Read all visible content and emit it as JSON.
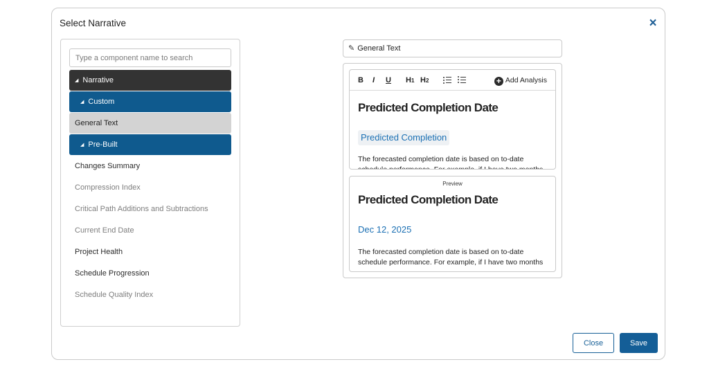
{
  "dialog": {
    "title": "Select Narrative",
    "close_icon": "×"
  },
  "search": {
    "placeholder": "Type a component name to search",
    "value": ""
  },
  "tree": {
    "expand_glyph": "◢",
    "narrative": "Narrative",
    "custom": "Custom",
    "general_text": "General Text",
    "pre_built": "Pre-Built",
    "items": [
      "Changes Summary",
      "Compression Index",
      "Critical Path Additions and Subtractions",
      "Current End Date",
      "Project Health",
      "Schedule Progression",
      "Schedule Quality Index"
    ]
  },
  "component_field": {
    "icon": "pencil-icon",
    "value": "General Text"
  },
  "toolbar": {
    "bold": "B",
    "italic": "I",
    "underline": "U",
    "h1": "H",
    "h1_sub": "1",
    "h2": "H",
    "h2_sub": "2",
    "add_analysis": "Add Analysis",
    "add_icon": "+"
  },
  "editor": {
    "heading": "Predicted Completion Date",
    "token": "Predicted Completion",
    "body": "The forecasted completion date is based on to-date schedule performance. For example, if I have two months"
  },
  "preview": {
    "label": "Preview",
    "heading": "Predicted Completion Date",
    "date": "Dec 12, 2025",
    "body": "The forecasted completion date is based on to-date schedule performance. For example, if I have two months"
  },
  "footer": {
    "close_label": "Close",
    "save_label": "Save"
  },
  "colors": {
    "accent": "#145e97",
    "link": "#1a6fb3",
    "dark_row": "#333333",
    "selected_row": "#d3d3d3"
  }
}
